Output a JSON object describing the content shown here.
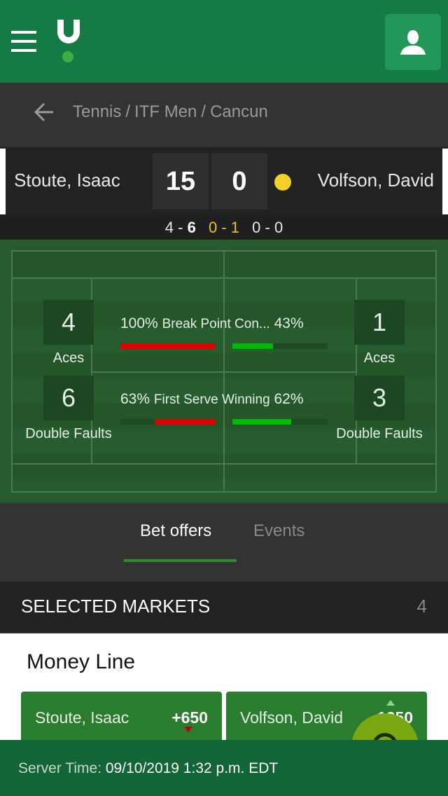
{
  "header": {
    "menu_icon": "hamburger-icon",
    "logo": "unibet-logo",
    "account_icon": "user-icon"
  },
  "breadcrumb": {
    "back_icon": "arrow-left-icon",
    "items": [
      "Tennis",
      "ITF Men",
      "Cancun"
    ],
    "separator": "/"
  },
  "scoreboard": {
    "player_home": "Stoute, Isaac",
    "player_away": "Volfson, David",
    "points_home": "15",
    "points_away": "0",
    "serving": "away",
    "serve_indicator_color": "#f6d02a",
    "sets": [
      {
        "home": "4",
        "away": "6"
      },
      {
        "home": "0",
        "away": "1",
        "current": true
      },
      {
        "home": "0",
        "away": "0"
      }
    ],
    "separator": "-"
  },
  "stats": {
    "home": {
      "aces_value": "4",
      "aces_label": "Aces",
      "double_faults_value": "6",
      "double_faults_label": "Double Faults"
    },
    "away": {
      "aces_value": "1",
      "aces_label": "Aces",
      "double_faults_value": "3",
      "double_faults_label": "Double Faults"
    },
    "bars": [
      {
        "label": "Break Point Con...",
        "home_pct_text": "100%",
        "away_pct_text": "43%",
        "home_pct": 100,
        "away_pct": 43
      },
      {
        "label": "First Serve Winning",
        "home_pct_text": "63%",
        "away_pct_text": "62%",
        "home_pct": 63,
        "away_pct": 62
      }
    ],
    "home_bar_color": "#e00000",
    "away_bar_color": "#00b900"
  },
  "tabs": {
    "items": [
      {
        "label": "Bet offers",
        "active": true
      },
      {
        "label": "Events",
        "active": false
      }
    ]
  },
  "markets": {
    "title": "SELECTED MARKETS",
    "count": "4",
    "money_line": {
      "title": "Money Line",
      "outcomes": [
        {
          "name": "Stoute, Isaac",
          "odds": "+650",
          "trend": "down"
        },
        {
          "name": "Volfson, David",
          "odds": "-1250",
          "trend": "up"
        }
      ]
    }
  },
  "footer": {
    "server_time_label": "Server Time:",
    "server_time_value": "09/10/2019 1:32 p.m. EDT"
  }
}
